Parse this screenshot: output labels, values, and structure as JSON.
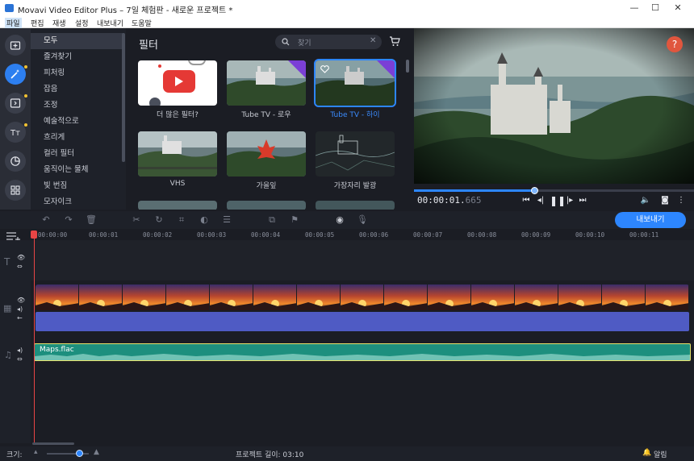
{
  "window": {
    "title": "Movavi Video Editor Plus – 7일 체험판 - 새로운 프로젝트 *"
  },
  "menu": [
    "파일",
    "편집",
    "재생",
    "설정",
    "내보내기",
    "도움말"
  ],
  "sidebar_icons": [
    "import-icon",
    "filters-icon",
    "transitions-icon",
    "titles-icon",
    "stickers-icon",
    "more-tools-icon"
  ],
  "categories": {
    "items": [
      "모두",
      "즐겨찾기",
      "피처링",
      "잡음",
      "조정",
      "예술적으로",
      "흐리게",
      "컬러 필터",
      "움직이는 물체",
      "빛 번짐",
      "모자이크"
    ],
    "selected": "모두"
  },
  "filters_panel": {
    "title": "필터",
    "search_placeholder": "찾기",
    "cards": [
      {
        "label": "더 많은 필터?",
        "kind": "youtube",
        "new": false,
        "selected": false
      },
      {
        "label": "Tube TV - 로우",
        "kind": "castle",
        "new": true,
        "selected": false
      },
      {
        "label": "Tube TV - 하이",
        "kind": "castle",
        "new": true,
        "selected": true
      },
      {
        "label": "VHS",
        "kind": "castle",
        "new": false,
        "selected": false
      },
      {
        "label": "가을잎",
        "kind": "leaf",
        "new": false,
        "selected": false
      },
      {
        "label": "가장자리 발광",
        "kind": "edges",
        "new": false,
        "selected": false
      }
    ],
    "new_tag": "NEW"
  },
  "player": {
    "timecode_main": "00:00:01.",
    "timecode_ms": "665",
    "progress": 0.43,
    "help_label": "?"
  },
  "toolbar": {
    "export_label": "내보내기"
  },
  "ruler": {
    "ticks": [
      "00:00:00",
      "00:00:01",
      "00:00:02",
      "00:00:03",
      "00:00:04",
      "00:00:05",
      "00:00:06",
      "00:00:07",
      "00:00:08",
      "00:00:09",
      "00:00:10",
      "00:00:11"
    ]
  },
  "timeline": {
    "audio_clip_name": "Maps.flac"
  },
  "statusbar": {
    "zoom_label": "크기:",
    "project_length_label": "프로젝트 길이: 03:10",
    "notifications_label": "알림"
  },
  "colors": {
    "accent": "#2d86ff",
    "playhead": "#e84545",
    "audio_clip": "#1d8f7e",
    "overlay_track": "#4f5bc4",
    "help": "#e0563e"
  }
}
